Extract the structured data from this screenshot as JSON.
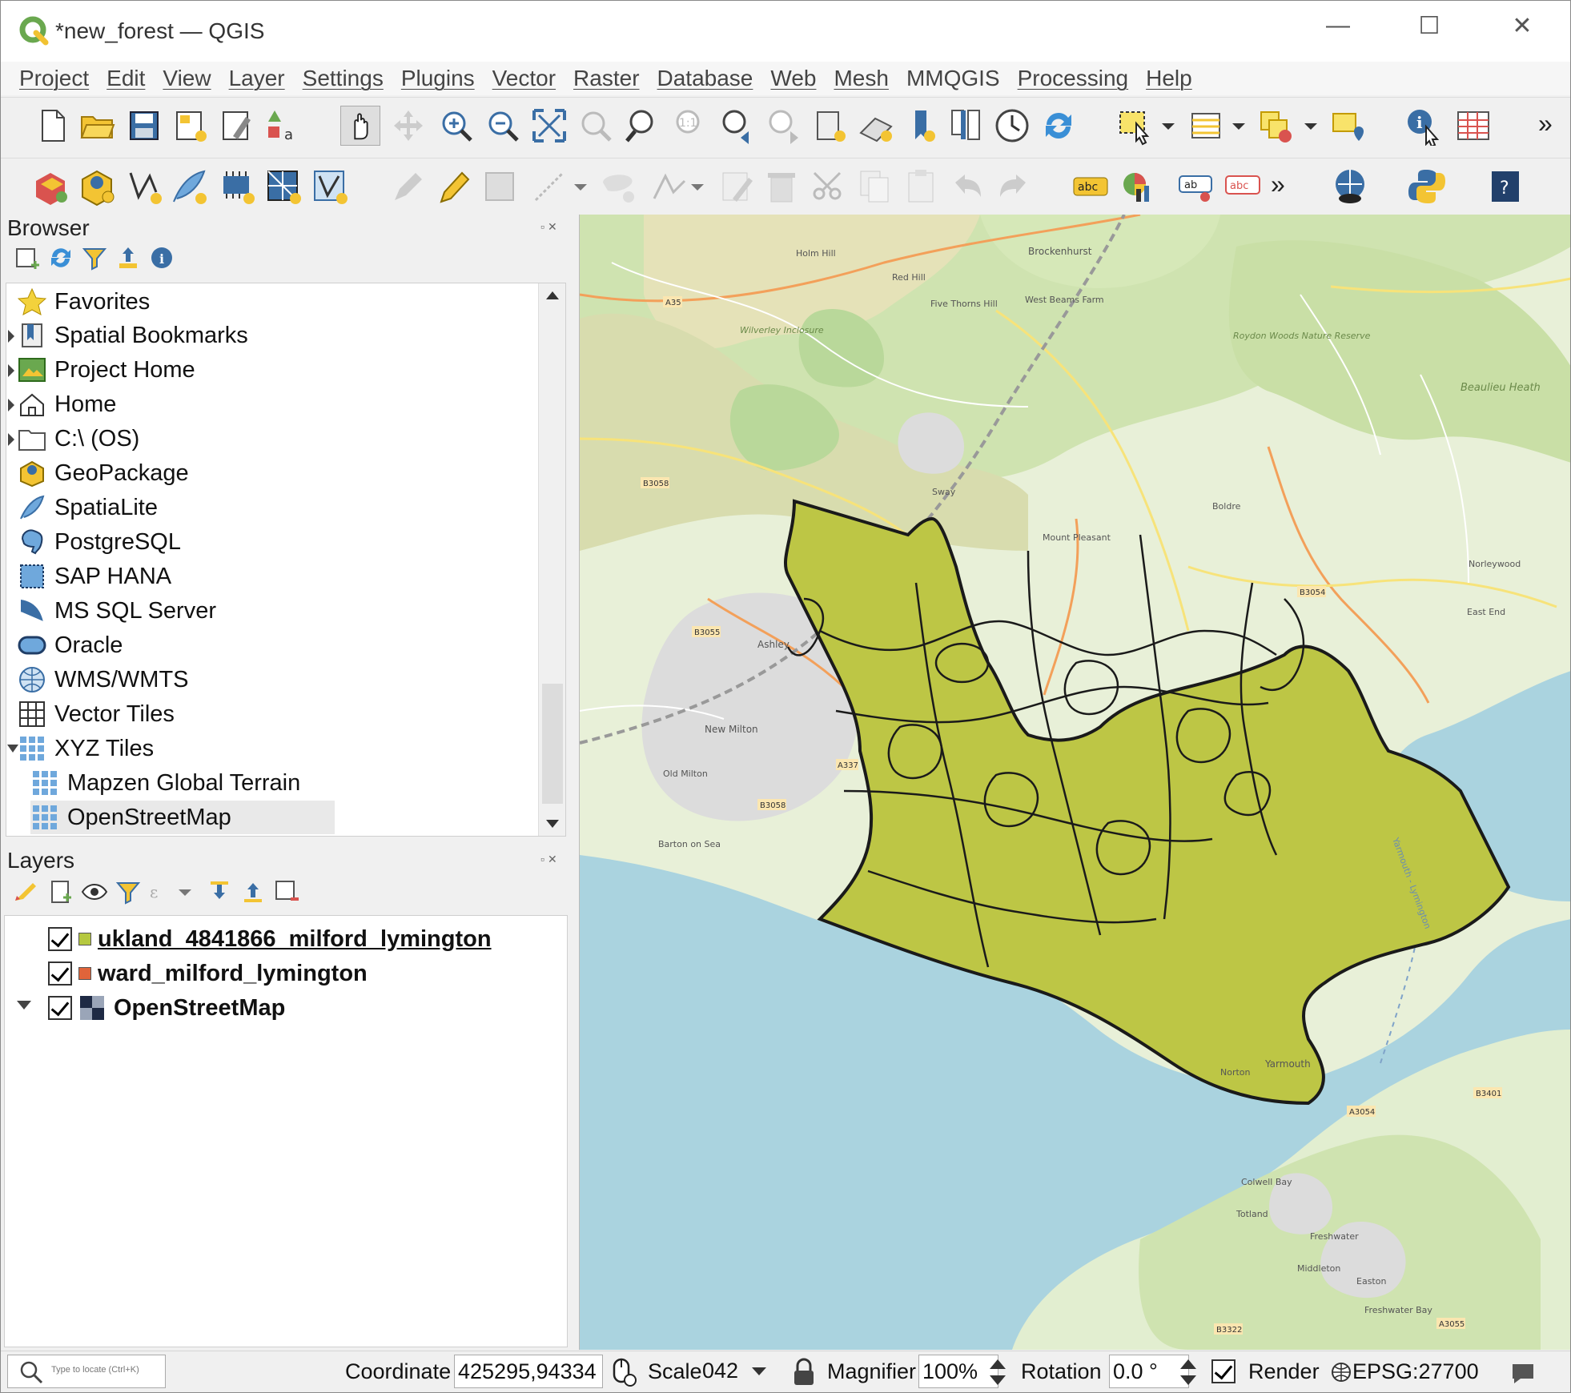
{
  "window": {
    "title": "*new_forest — QGIS",
    "controls": {
      "minimize": "—",
      "maximize": "☐",
      "close": "✕"
    }
  },
  "menu": [
    "Project",
    "Edit",
    "View",
    "Layer",
    "Settings",
    "Plugins",
    "Vector",
    "Raster",
    "Database",
    "Web",
    "Mesh",
    "MMQGIS",
    "Processing",
    "Help"
  ],
  "toolbar": {
    "overflow": "»"
  },
  "browser": {
    "title": "Browser",
    "items": [
      {
        "label": "Favorites",
        "icon": "star-icon"
      },
      {
        "label": "Spatial Bookmarks",
        "icon": "bookmark-icon"
      },
      {
        "label": "Project Home",
        "icon": "project-home-icon"
      },
      {
        "label": "Home",
        "icon": "home-icon"
      },
      {
        "label": "C:\\ (OS)",
        "icon": "folder-icon"
      },
      {
        "label": "GeoPackage",
        "icon": "geopackage-icon"
      },
      {
        "label": "SpatiaLite",
        "icon": "feather-icon"
      },
      {
        "label": "PostgreSQL",
        "icon": "elephant-icon"
      },
      {
        "label": "SAP HANA",
        "icon": "hana-icon"
      },
      {
        "label": "MS SQL Server",
        "icon": "mssql-icon"
      },
      {
        "label": "Oracle",
        "icon": "oracle-icon"
      },
      {
        "label": "WMS/WMTS",
        "icon": "globe-icon"
      },
      {
        "label": "Vector Tiles",
        "icon": "grid-icon"
      },
      {
        "label": "XYZ Tiles",
        "icon": "tiles-icon"
      },
      {
        "label": "Mapzen Global Terrain",
        "icon": "tiles-icon"
      },
      {
        "label": "OpenStreetMap",
        "icon": "tiles-icon"
      }
    ]
  },
  "layers": {
    "title": "Layers",
    "items": [
      {
        "label": "ukland_4841866_milford_lymington",
        "color": "#b5c83f",
        "checked": true,
        "active": true
      },
      {
        "label": "ward_milford_lymington",
        "color": "#e0643a",
        "checked": true,
        "active": false
      },
      {
        "label": "OpenStreetMap",
        "color": "#2a3550",
        "checked": true,
        "active": false
      }
    ]
  },
  "map": {
    "polygon_fill": "#bdc645",
    "sea_color": "#aad3df",
    "land_color": "#eaf1d9",
    "labels": [
      "Brockenhurst",
      "Holm Hill",
      "Red Hill",
      "Five Thorns Hill",
      "West Beams Farm",
      "Wilverley Inclosure",
      "Roydon Woods Nature Reserve",
      "Beaulieu Heath",
      "Boldre",
      "Mount Pleasant",
      "Sway",
      "Ashley",
      "New Milton",
      "Old Milton",
      "Barton on Sea",
      "Norleywood",
      "East End",
      "Yarmouth",
      "Norton",
      "Colwell Bay",
      "Totland",
      "Freshwater",
      "Middleton",
      "Easton",
      "Freshwater Bay",
      "A35",
      "B3055",
      "B3058",
      "A337",
      "B3054",
      "A3054",
      "B3401",
      "B3322",
      "A3055",
      "Lymington",
      "Yarmouth - Lymington"
    ]
  },
  "status": {
    "locate_placeholder": "Type to locate (Ctrl+K)",
    "coordinate_label": "Coordinate",
    "coordinate_value": "425295,94334",
    "scale_label": "Scale",
    "scale_value": "042",
    "magnifier_label": "Magnifier",
    "magnifier_value": "100%",
    "rotation_label": "Rotation",
    "rotation_value": "0.0 °",
    "render_label": "Render",
    "crs": "EPSG:27700"
  }
}
